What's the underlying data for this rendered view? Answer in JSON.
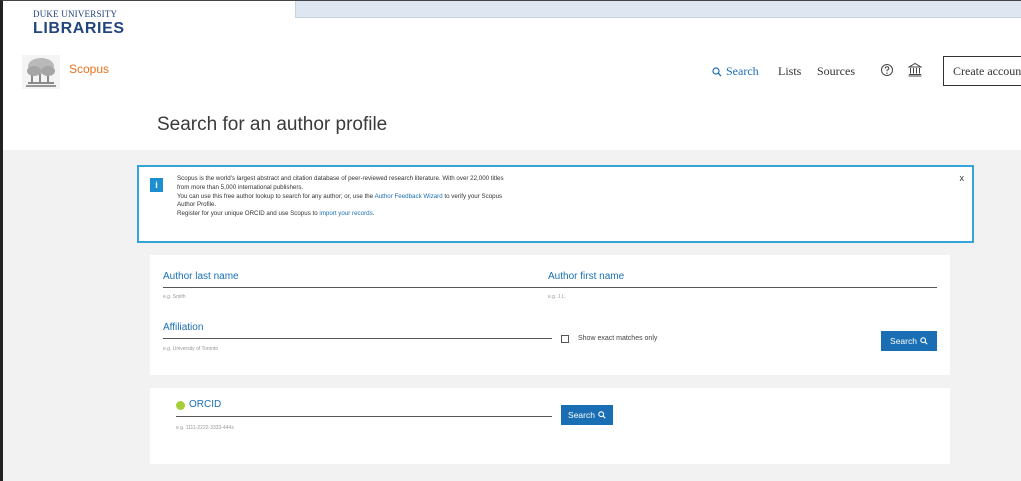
{
  "branding": {
    "duke_small": "DUKE UNIVERSITY",
    "duke_big": "LIBRARIES",
    "scopus_name": "Scopus"
  },
  "nav": {
    "search": "Search",
    "lists": "Lists",
    "sources": "Sources",
    "create_account": "Create account"
  },
  "page": {
    "title": "Search for an author profile"
  },
  "info": {
    "icon": "i",
    "line1": "Scopus is the world's largest abstract and citation database of peer-reviewed research literature. With over 22,000 titles",
    "line2": "from more than 5,000 international publishers.",
    "line3_pre": "You can use this free author lookup to search for any author; or, use the ",
    "line3_link": "Author Feedback Wizard",
    "line3_post": " to verify your Scopus",
    "line4": "Author Profile.",
    "line5_pre": "Register for your unique ORCID and use Scopus to ",
    "line5_link": "import your records",
    "line5_post": ".",
    "close": "x"
  },
  "form": {
    "last_name_label": "Author last name",
    "last_name_hint": "e.g. Smith",
    "first_name_label": "Author first name",
    "first_name_hint": "e.g. J.L.",
    "affiliation_label": "Affiliation",
    "affiliation_hint": "e.g. University of Toronto",
    "exact_match_label": "Show exact matches only",
    "search_button": "Search"
  },
  "orcid": {
    "label": "ORCID",
    "hint": "e.g. 1111-2222-3333-444x",
    "search_button": "Search"
  },
  "colors": {
    "accent_blue": "#1a6fb4",
    "scopus_orange": "#e9711c",
    "info_border": "#35a5d9",
    "orcid_green": "#a6ce39"
  },
  "icons": {
    "nav_search": "search-icon",
    "help": "help-icon",
    "institution": "institution-icon",
    "info": "info-icon",
    "close": "close-icon",
    "orcid": "orcid-icon"
  }
}
